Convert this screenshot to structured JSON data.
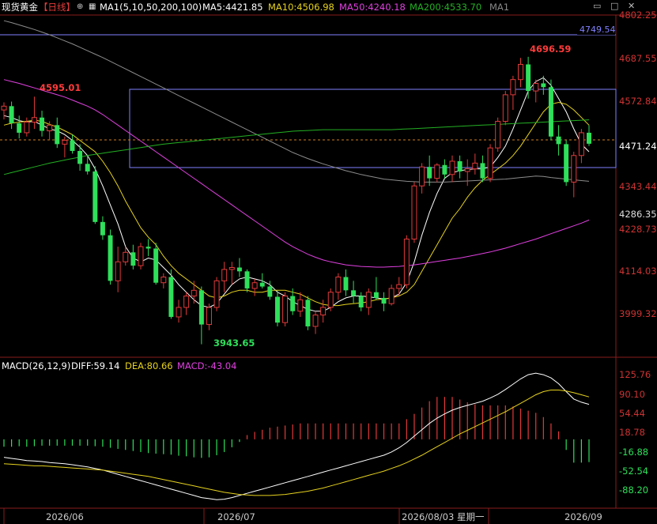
{
  "header": {
    "instrument": "现货黄金",
    "period": "【日线】",
    "ma_label": "MA1(5,10,50,200,100)",
    "ma5": "MA5:4421.85",
    "ma10": "MA10:4506.98",
    "ma50": "MA50:4240.18",
    "ma200": "MA200:4533.70",
    "ma1": "MA1",
    "colors": {
      "ma5": "#ffffff",
      "ma10": "#e6d21e",
      "ma50": "#e040e0",
      "ma200": "#23b023",
      "up": "#e23a3a",
      "down": "#2ee05a"
    }
  },
  "macd_header": {
    "label": "MACD(26,12,9)",
    "diff": "DIFF:59.14",
    "dea": "DEA:80.66",
    "macd": "MACD:-43.04"
  },
  "annotations": {
    "high_label": "4696.59",
    "left_high_label": "4595.01",
    "low_label": "3943.65",
    "hline_label": "4749.54",
    "last_price": "4471.24"
  },
  "chart_data": [
    {
      "type": "candlestick",
      "title": "现货黄金【日线】",
      "ylim": [
        3940,
        4810
      ],
      "y_ticks": [
        "4802.25",
        "4687.55",
        "4572.84",
        "4343.44",
        "4286.35",
        "4228.73",
        "4114.03",
        "3999.32"
      ],
      "x_ticks": [
        "2026/06",
        "2026/07",
        "2026/08/03 星期一",
        "2026/09"
      ],
      "annotated_high": 4696.59,
      "annotated_low": 3943.65,
      "annotated_left_high": 4595.01,
      "horizontal_line": 4749.54,
      "box": {
        "top": 4608,
        "bottom": 4405
      },
      "last_price": 4471.24,
      "ohlc": [
        [
          4560,
          4580,
          4535,
          4570
        ],
        [
          4570,
          4582,
          4510,
          4525
        ],
        [
          4525,
          4545,
          4485,
          4500
        ],
        [
          4500,
          4540,
          4490,
          4528
        ],
        [
          4528,
          4595,
          4510,
          4540
        ],
        [
          4540,
          4558,
          4490,
          4505
        ],
        [
          4505,
          4530,
          4480,
          4520
        ],
        [
          4520,
          4540,
          4460,
          4470
        ],
        [
          4470,
          4490,
          4435,
          4480
        ],
        [
          4480,
          4495,
          4445,
          4452
        ],
        [
          4452,
          4470,
          4400,
          4418
        ],
        [
          4418,
          4440,
          4390,
          4398
        ],
        [
          4398,
          4412,
          4260,
          4265
        ],
        [
          4265,
          4280,
          4218,
          4230
        ],
        [
          4230,
          4245,
          4100,
          4110
        ],
        [
          4110,
          4200,
          4080,
          4160
        ],
        [
          4160,
          4200,
          4150,
          4185
        ],
        [
          4185,
          4205,
          4140,
          4150
        ],
        [
          4150,
          4210,
          4140,
          4200
        ],
        [
          4200,
          4220,
          4175,
          4195
        ],
        [
          4195,
          4210,
          4100,
          4105
        ],
        [
          4105,
          4130,
          4090,
          4120
        ],
        [
          4120,
          4140,
          4010,
          4015
        ],
        [
          4015,
          4060,
          4000,
          4040
        ],
        [
          4040,
          4080,
          4020,
          4070
        ],
        [
          4070,
          4110,
          4050,
          4085
        ],
        [
          4085,
          4095,
          3943,
          3995
        ],
        [
          3995,
          4050,
          3980,
          4040
        ],
        [
          4040,
          4120,
          4030,
          4110
        ],
        [
          4110,
          4160,
          4080,
          4140
        ],
        [
          4140,
          4160,
          4100,
          4145
        ],
        [
          4145,
          4170,
          4120,
          4135
        ],
        [
          4135,
          4140,
          4080,
          4090
        ],
        [
          4090,
          4115,
          4070,
          4105
        ],
        [
          4105,
          4130,
          4090,
          4095
        ],
        [
          4095,
          4110,
          4060,
          4068
        ],
        [
          4068,
          4085,
          3990,
          4000
        ],
        [
          4000,
          4080,
          3990,
          4070
        ],
        [
          4070,
          4090,
          4020,
          4030
        ],
        [
          4030,
          4080,
          4015,
          4060
        ],
        [
          4060,
          4070,
          3980,
          3990
        ],
        [
          3990,
          4030,
          3970,
          4020
        ],
        [
          4020,
          4060,
          4000,
          4040
        ],
        [
          4040,
          4090,
          4030,
          4080
        ],
        [
          4080,
          4130,
          4060,
          4120
        ],
        [
          4120,
          4140,
          4070,
          4085
        ],
        [
          4085,
          4110,
          4050,
          4070
        ],
        [
          4070,
          4080,
          4030,
          4040
        ],
        [
          4040,
          4090,
          4020,
          4080
        ],
        [
          4080,
          4120,
          4060,
          4065
        ],
        [
          4065,
          4080,
          4030,
          4050
        ],
        [
          4050,
          4100,
          4045,
          4090
        ],
        [
          4090,
          4120,
          4070,
          4100
        ],
        [
          4100,
          4230,
          4090,
          4220
        ],
        [
          4220,
          4370,
          4210,
          4360
        ],
        [
          4360,
          4420,
          4340,
          4410
        ],
        [
          4410,
          4440,
          4360,
          4380
        ],
        [
          4380,
          4420,
          4370,
          4415
        ],
        [
          4415,
          4430,
          4380,
          4390
        ],
        [
          4390,
          4440,
          4370,
          4425
        ],
        [
          4425,
          4440,
          4380,
          4398
        ],
        [
          4398,
          4430,
          4360,
          4405
        ],
        [
          4405,
          4445,
          4390,
          4420
        ],
        [
          4420,
          4440,
          4370,
          4380
        ],
        [
          4380,
          4470,
          4370,
          4460
        ],
        [
          4460,
          4540,
          4450,
          4530
        ],
        [
          4530,
          4610,
          4520,
          4600
        ],
        [
          4600,
          4650,
          4560,
          4640
        ],
        [
          4640,
          4697,
          4620,
          4680
        ],
        [
          4680,
          4700,
          4590,
          4610
        ],
        [
          4610,
          4640,
          4580,
          4630
        ],
        [
          4630,
          4650,
          4600,
          4620
        ],
        [
          4620,
          4640,
          4480,
          4490
        ],
        [
          4490,
          4520,
          4440,
          4470
        ],
        [
          4470,
          4480,
          4360,
          4370
        ],
        [
          4370,
          4450,
          4330,
          4440
        ],
        [
          4440,
          4510,
          4420,
          4500
        ],
        [
          4500,
          4520,
          4465,
          4471
        ]
      ],
      "ma_series": [
        {
          "name": "MA5",
          "values": [
            4545,
            4540,
            4532,
            4528,
            4530,
            4520,
            4510,
            4505,
            4495,
            4480,
            4462,
            4440,
            4405,
            4360,
            4310,
            4260,
            4200,
            4170,
            4160,
            4170,
            4165,
            4145,
            4125,
            4100,
            4080,
            4060,
            4045,
            4040,
            4050,
            4075,
            4100,
            4115,
            4120,
            4115,
            4110,
            4100,
            4080,
            4070,
            4055,
            4045,
            4035,
            4030,
            4030,
            4040,
            4055,
            4065,
            4070,
            4070,
            4068,
            4065,
            4062,
            4065,
            4075,
            4105,
            4160,
            4230,
            4290,
            4340,
            4380,
            4395,
            4400,
            4403,
            4405,
            4405,
            4410,
            4435,
            4465,
            4510,
            4560,
            4610,
            4635,
            4645,
            4625,
            4590,
            4555,
            4510,
            4470,
            4450
          ]
        },
        {
          "name": "MA10",
          "values": [
            4520,
            4525,
            4528,
            4530,
            4533,
            4530,
            4522,
            4515,
            4505,
            4495,
            4480,
            4465,
            4450,
            4425,
            4395,
            4360,
            4320,
            4285,
            4250,
            4225,
            4205,
            4175,
            4150,
            4130,
            4115,
            4100,
            4085,
            4070,
            4065,
            4070,
            4080,
            4085,
            4085,
            4080,
            4080,
            4085,
            4085,
            4085,
            4080,
            4075,
            4065,
            4055,
            4048,
            4045,
            4045,
            4048,
            4050,
            4052,
            4055,
            4060,
            4062,
            4065,
            4070,
            4080,
            4100,
            4135,
            4170,
            4205,
            4240,
            4275,
            4300,
            4330,
            4355,
            4375,
            4390,
            4405,
            4420,
            4440,
            4465,
            4495,
            4525,
            4555,
            4575,
            4580,
            4575,
            4560,
            4540,
            4520
          ]
        },
        {
          "name": "MA50",
          "values": [
            4640,
            4635,
            4630,
            4624,
            4618,
            4612,
            4606,
            4600,
            4594,
            4586,
            4578,
            4570,
            4560,
            4548,
            4534,
            4520,
            4506,
            4492,
            4478,
            4464,
            4450,
            4436,
            4422,
            4408,
            4394,
            4380,
            4366,
            4352,
            4338,
            4324,
            4310,
            4296,
            4282,
            4268,
            4254,
            4240,
            4226,
            4212,
            4200,
            4190,
            4180,
            4172,
            4165,
            4160,
            4156,
            4152,
            4150,
            4148,
            4147,
            4146,
            4146,
            4147,
            4148,
            4150,
            4152,
            4155,
            4158,
            4161,
            4164,
            4167,
            4170,
            4174,
            4178,
            4182,
            4186,
            4191,
            4196,
            4202,
            4208,
            4214,
            4220,
            4227,
            4234,
            4241,
            4248,
            4255,
            4262,
            4270
          ]
        },
        {
          "name": "MA100",
          "values": [
            4795,
            4790,
            4784,
            4778,
            4772,
            4765,
            4758,
            4750,
            4742,
            4734,
            4725,
            4716,
            4707,
            4698,
            4688,
            4678,
            4668,
            4658,
            4648,
            4638,
            4628,
            4618,
            4608,
            4598,
            4588,
            4578,
            4568,
            4558,
            4548,
            4538,
            4528,
            4518,
            4508,
            4498,
            4488,
            4478,
            4468,
            4458,
            4448,
            4440,
            4432,
            4425,
            4418,
            4412,
            4406,
            4400,
            4395,
            4390,
            4386,
            4382,
            4378,
            4376,
            4374,
            4372,
            4371,
            4370,
            4370,
            4370,
            4370,
            4371,
            4372,
            4373,
            4374,
            4375,
            4376,
            4377,
            4378,
            4380,
            4382,
            4384,
            4386,
            4385,
            4382,
            4380,
            4378,
            4376,
            4374,
            4372
          ]
        },
        {
          "name": "MA200",
          "values": [
            4390,
            4395,
            4400,
            4405,
            4410,
            4415,
            4420,
            4424,
            4428,
            4432,
            4436,
            4440,
            4443,
            4446,
            4449,
            4452,
            4455,
            4458,
            4461,
            4464,
            4467,
            4470,
            4472,
            4474,
            4476,
            4478,
            4480,
            4482,
            4484,
            4486,
            4488,
            4490,
            4492,
            4494,
            4496,
            4498,
            4500,
            4502,
            4504,
            4505,
            4506,
            4507,
            4508,
            4508,
            4508,
            4508,
            4508,
            4508,
            4508,
            4508,
            4508,
            4508,
            4509,
            4510,
            4511,
            4512,
            4513,
            4514,
            4515,
            4516,
            4517,
            4518,
            4519,
            4520,
            4521,
            4522,
            4523,
            4524,
            4525,
            4526,
            4527,
            4528,
            4529,
            4530,
            4531,
            4532,
            4533,
            4534
          ]
        }
      ]
    },
    {
      "type": "macd",
      "title": "MACD(26,12,9)",
      "ylim": [
        -130,
        140
      ],
      "y_ticks": [
        "125.76",
        "90.10",
        "54.44",
        "18.78",
        "-16.88",
        "-52.54",
        "-88.20"
      ],
      "series": [
        {
          "name": "DIFF",
          "values": [
            -34,
            -36,
            -38,
            -40,
            -41,
            -42,
            -44,
            -45,
            -46,
            -48,
            -50,
            -52,
            -55,
            -58,
            -62,
            -66,
            -70,
            -74,
            -78,
            -82,
            -86,
            -90,
            -94,
            -98,
            -102,
            -106,
            -110,
            -112,
            -114,
            -113,
            -110,
            -106,
            -102,
            -98,
            -94,
            -90,
            -86,
            -82,
            -78,
            -74,
            -70,
            -66,
            -62,
            -58,
            -54,
            -50,
            -46,
            -42,
            -38,
            -34,
            -30,
            -24,
            -16,
            -6,
            6,
            18,
            30,
            40,
            48,
            55,
            60,
            64,
            68,
            72,
            78,
            85,
            94,
            104,
            114,
            122,
            125,
            122,
            116,
            105,
            90,
            76,
            70,
            66
          ]
        },
        {
          "name": "DEA",
          "values": [
            -46,
            -47,
            -48,
            -49,
            -50,
            -50,
            -51,
            -52,
            -53,
            -54,
            -55,
            -56,
            -57,
            -58,
            -60,
            -62,
            -64,
            -66,
            -68,
            -70,
            -73,
            -76,
            -79,
            -82,
            -85,
            -88,
            -91,
            -94,
            -97,
            -100,
            -102,
            -104,
            -105,
            -106,
            -106,
            -106,
            -105,
            -104,
            -102,
            -100,
            -98,
            -95,
            -92,
            -88,
            -84,
            -80,
            -76,
            -72,
            -68,
            -64,
            -60,
            -55,
            -50,
            -44,
            -37,
            -30,
            -22,
            -14,
            -6,
            2,
            10,
            17,
            24,
            31,
            38,
            45,
            52,
            60,
            68,
            76,
            84,
            90,
            93,
            93,
            91,
            88,
            84,
            80
          ]
        },
        {
          "name": "MACD",
          "values": [
            -14,
            -14,
            -13,
            -14,
            -13,
            -12,
            -12,
            -12,
            -12,
            -12,
            -12,
            -12,
            -13,
            -14,
            -16,
            -18,
            -20,
            -22,
            -24,
            -26,
            -27,
            -28,
            -29,
            -31,
            -32,
            -34,
            -35,
            -34,
            -30,
            -24,
            -15,
            -5,
            8,
            14,
            18,
            22,
            24,
            26,
            28,
            30,
            30,
            30,
            30,
            30,
            30,
            30,
            30,
            30,
            30,
            30,
            30,
            30,
            30,
            38,
            48,
            60,
            72,
            80,
            80,
            80,
            75,
            70,
            66,
            64,
            64,
            64,
            64,
            62,
            58,
            54,
            50,
            42,
            30,
            15,
            -20,
            -44,
            -44,
            -43
          ]
        }
      ]
    }
  ]
}
